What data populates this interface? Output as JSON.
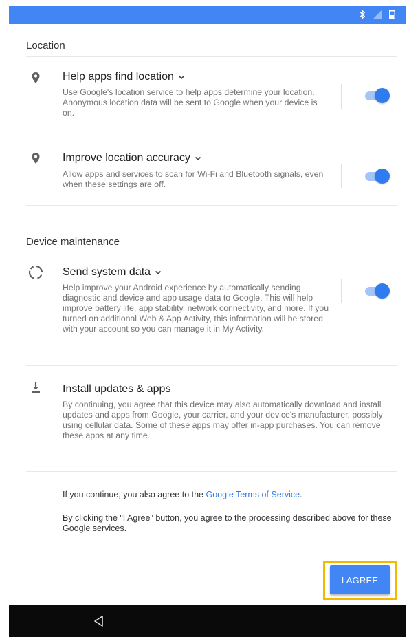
{
  "status_bar": {
    "icons": [
      "bluetooth-icon",
      "signal-icon",
      "battery-icon"
    ],
    "color": "#4285f4"
  },
  "sections": {
    "location": {
      "title": "Location",
      "items": [
        {
          "title": "Help apps find location",
          "description": "Use Google's location service to help apps determine your location. Anonymous location data will be sent to Google when your device is on.",
          "icon": "location-pin-icon",
          "toggle_on": true
        },
        {
          "title": "Improve location accuracy",
          "description": "Allow apps and services to scan for Wi-Fi and Bluetooth signals, even when these settings are off.",
          "icon": "location-pin-icon",
          "toggle_on": true
        }
      ]
    },
    "device_maintenance": {
      "title": "Device maintenance",
      "items": [
        {
          "title": "Send system data",
          "description": "Help improve your Android experience by automatically sending diagnostic and device and app usage data to Google. This will help improve battery life, app stability, network connectivity, and more. If you turned on additional Web & App Activity, this information will be stored with your account so you can manage it in My Activity.",
          "icon": "loading-circle-icon",
          "toggle_on": true
        },
        {
          "title": "Install updates & apps",
          "description": "By continuing, you agree that this device may also automatically download and install updates and apps from Google, your carrier, and your device's manufacturer, possibly using cellular data. Some of these apps may offer in-app purchases. You can remove these apps at any time.",
          "icon": "download-icon"
        }
      ]
    }
  },
  "footer": {
    "continue_prefix": "If you continue, you also agree to the ",
    "terms_link": "Google Terms of Service",
    "continue_suffix": ".",
    "agree_notice": "By clicking the \"I Agree\" button, you agree to the processing described above for these Google services."
  },
  "agree_button": {
    "label": "I AGREE",
    "color": "#4285f4",
    "highlight_color": "#f5b800"
  },
  "nav_bar": {
    "back_icon": "back-triangle-icon"
  }
}
